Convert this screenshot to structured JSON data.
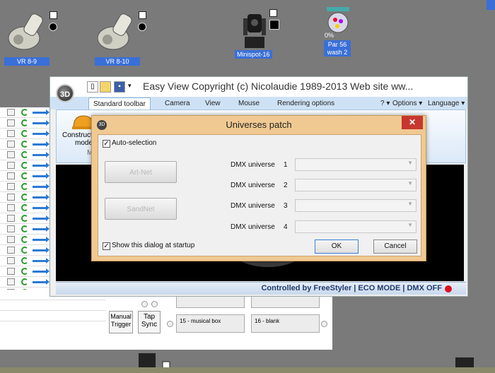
{
  "fixtures": [
    {
      "label": "VR 8-9"
    },
    {
      "label": "VR 8-10"
    },
    {
      "label": "Minispot-16"
    },
    {
      "label": "Par 56 wash 2",
      "label_line1": "Par 56",
      "label_line2": "wash 2",
      "percent": "0%"
    }
  ],
  "easyview": {
    "logo": "3D",
    "title": "Easy View   Copyright (c) Nicolaudie 1989-2013   Web site ww...",
    "tabs": [
      {
        "label": "Standard toolbar"
      },
      {
        "label": "Camera"
      },
      {
        "label": "View"
      },
      {
        "label": "Mouse"
      },
      {
        "label": "Rendering options"
      }
    ],
    "help": "? ▾",
    "options": "Options ▾",
    "language": "Language ▾",
    "ribbon_items": {
      "construct_label": "Construct",
      "mode_label": "mode",
      "m_label": "M"
    },
    "status": "Controlled by FreeStyler  |  ECO MODE  |  DMX OFF"
  },
  "dialog": {
    "title": "Universes patch",
    "auto_selection": "Auto-selection",
    "artnet": "Art-Net",
    "sandnet": "SandNet",
    "universes": [
      {
        "label": "DMX universe",
        "num": "1"
      },
      {
        "label": "DMX universe",
        "num": "2"
      },
      {
        "label": "DMX universe",
        "num": "3"
      },
      {
        "label": "DMX universe",
        "num": "4"
      }
    ],
    "show_at_startup": "Show this dialog at startup",
    "ok": "OK",
    "cancel": "Cancel",
    "close": "✕"
  },
  "lower": {
    "manual_trigger": "Manual Trigger",
    "manual_line1": "Manual",
    "manual_line2": "Trigger",
    "tap_sync": "Tap Sync",
    "tap_line1": "Tap",
    "tap_line2": "Sync",
    "preset_15": "15 - musical box",
    "preset_16": "16 - blank"
  }
}
